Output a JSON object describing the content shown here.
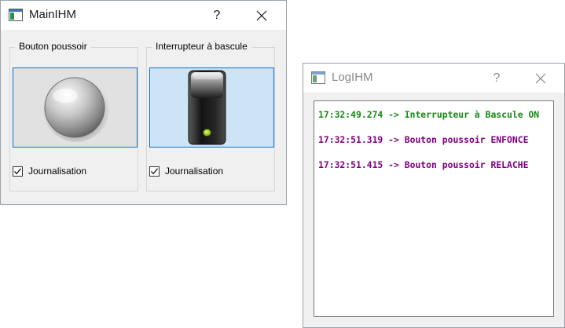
{
  "main_window": {
    "title": "MainIHM",
    "help_label": "?",
    "push_group": {
      "title": "Bouton poussoir",
      "checkbox_label": "Journalisation",
      "checked": true
    },
    "toggle_group": {
      "title": "Interrupteur à bascule",
      "checkbox_label": "Journalisation",
      "checked": true
    }
  },
  "log_window": {
    "title": "LogIHM",
    "help_label": "?",
    "entries": [
      {
        "text": "17:32:49.274 -> Interrupteur à Bascule ON",
        "color": "#138a13"
      },
      {
        "text": "17:32:51.319 -> Bouton poussoir ENFONCE",
        "color": "#800080"
      },
      {
        "text": "17:32:51.415 -> Bouton poussoir RELACHE",
        "color": "#800080"
      }
    ]
  },
  "colors": {
    "accent_border": "#0f6fc6",
    "toggle_bg": "#cde4f7",
    "led": "#9be010"
  },
  "icons": [
    "window-icon",
    "close-icon",
    "checkmark-icon",
    "push-button-knob-icon",
    "toggle-switch-icon"
  ]
}
